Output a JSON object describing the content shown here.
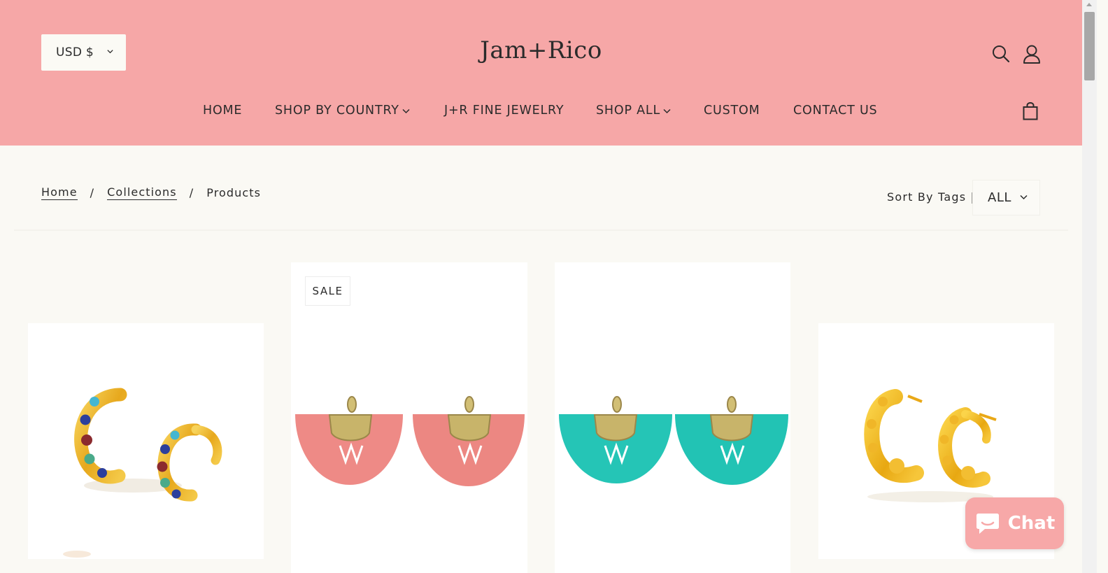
{
  "header": {
    "currency": "USD $",
    "logo": "Jam+Rico",
    "nav": [
      {
        "label": "HOME",
        "dropdown": false
      },
      {
        "label": "SHOP BY COUNTRY",
        "dropdown": true
      },
      {
        "label": "J+R FINE JEWELRY",
        "dropdown": false
      },
      {
        "label": "SHOP ALL",
        "dropdown": true
      },
      {
        "label": "CUSTOM",
        "dropdown": false
      },
      {
        "label": "CONTACT US",
        "dropdown": false
      }
    ],
    "icons": [
      "search-icon",
      "account-icon",
      "shopping-bag-icon"
    ],
    "bg_color": "#f6a7a7"
  },
  "breadcrumb": {
    "items": [
      "Home",
      "Collections",
      "Products"
    ],
    "separator": "/"
  },
  "sort": {
    "label": "Sort By Tags |",
    "value": "ALL"
  },
  "products": [
    {
      "badge": "",
      "image": "gold-ear-cuffs-with-colored-stones"
    },
    {
      "badge": "SALE",
      "image": "pink-fan-tassel-earrings"
    },
    {
      "badge": "",
      "image": "turquoise-fan-tassel-earrings"
    },
    {
      "badge": "",
      "image": "gold-studded-hoop-earrings"
    }
  ],
  "chat": {
    "label": "Chat",
    "color": "#f7a8a8"
  }
}
